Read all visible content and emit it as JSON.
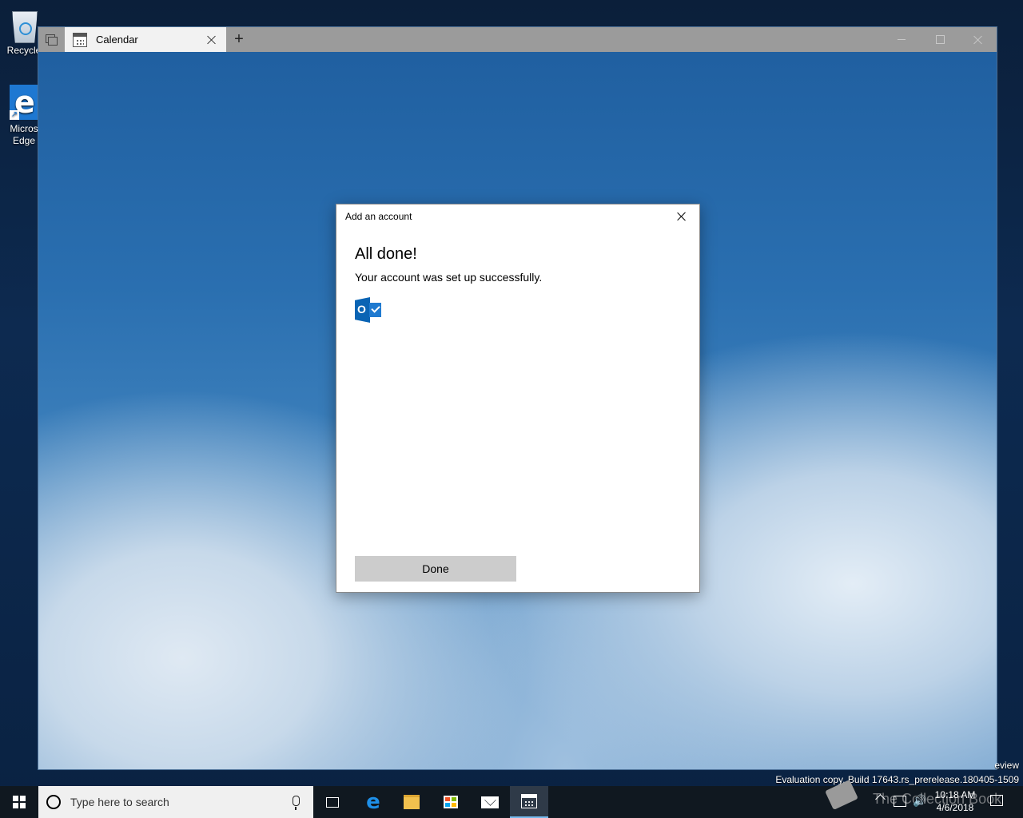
{
  "desktop": {
    "icons": [
      {
        "label": "Recycle"
      },
      {
        "label_line1": "Micros",
        "label_line2": "Edge"
      }
    ]
  },
  "window": {
    "tab_title": "Calendar",
    "new_tab_symbol": "+"
  },
  "dialog": {
    "title": "Add an account",
    "heading": "All done!",
    "message": "Your account was set up successfully.",
    "account_icon_letter": "O",
    "done_label": "Done"
  },
  "watermark": {
    "line1": "eview",
    "line2": "Evaluation copy. Build 17643.rs_prerelease.180405-1509",
    "overlay_text": "The Collection Book"
  },
  "taskbar": {
    "search_placeholder": "Type here to search",
    "edge_glyph": "e",
    "time": "10:18 AM",
    "date": "4/6/2018"
  },
  "colors": {
    "accent": "#0a64b4",
    "taskbar": "#101820",
    "titlebar": "#9b9b9b"
  }
}
